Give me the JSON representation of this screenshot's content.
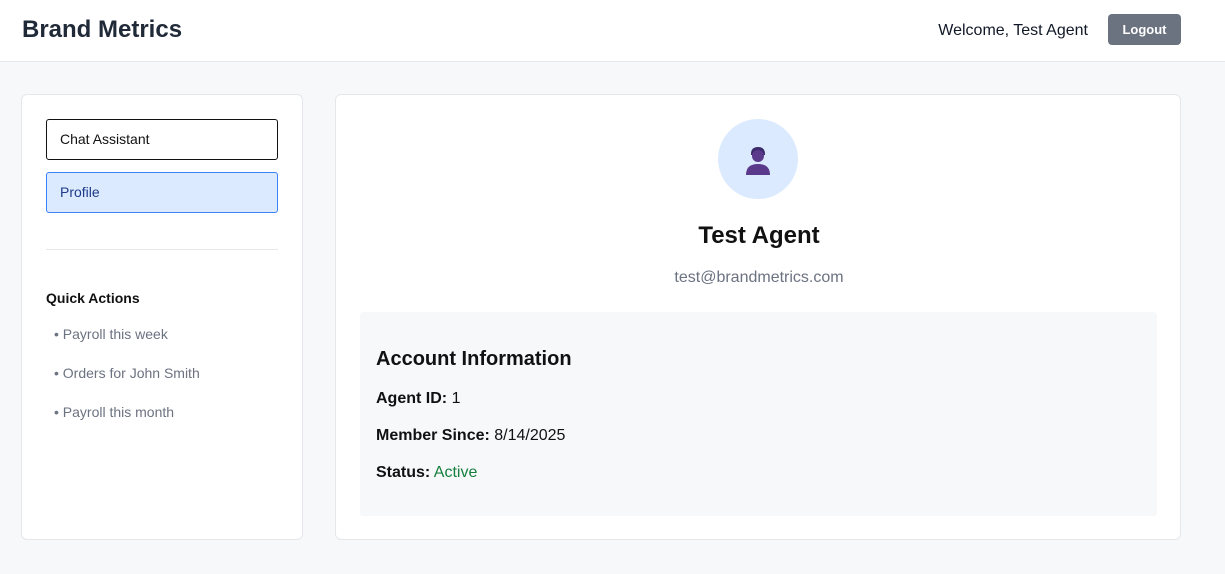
{
  "header": {
    "brand": "Brand Metrics",
    "welcome": "Welcome, Test Agent",
    "logout_label": "Logout"
  },
  "sidebar": {
    "nav": [
      {
        "label": "Chat Assistant",
        "active": false
      },
      {
        "label": "Profile",
        "active": true
      }
    ],
    "quick_actions_title": "Quick Actions",
    "quick_actions": [
      "• Payroll this week",
      "• Orders for John Smith",
      "• Payroll this month"
    ]
  },
  "profile": {
    "avatar_icon": "user-icon",
    "name": "Test Agent",
    "email": "test@brandmetrics.com",
    "account_title": "Account Information",
    "agent_id_label": "Agent ID:",
    "agent_id": "1",
    "member_since_label": "Member Since:",
    "member_since": "8/14/2025",
    "status_label": "Status:",
    "status": "Active"
  },
  "colors": {
    "accent": "#3b82f6",
    "active_bg": "#dbeafe",
    "status_active": "#15803d",
    "logout_bg": "#6b7280",
    "avatar_icon": "#5b3a8c"
  }
}
